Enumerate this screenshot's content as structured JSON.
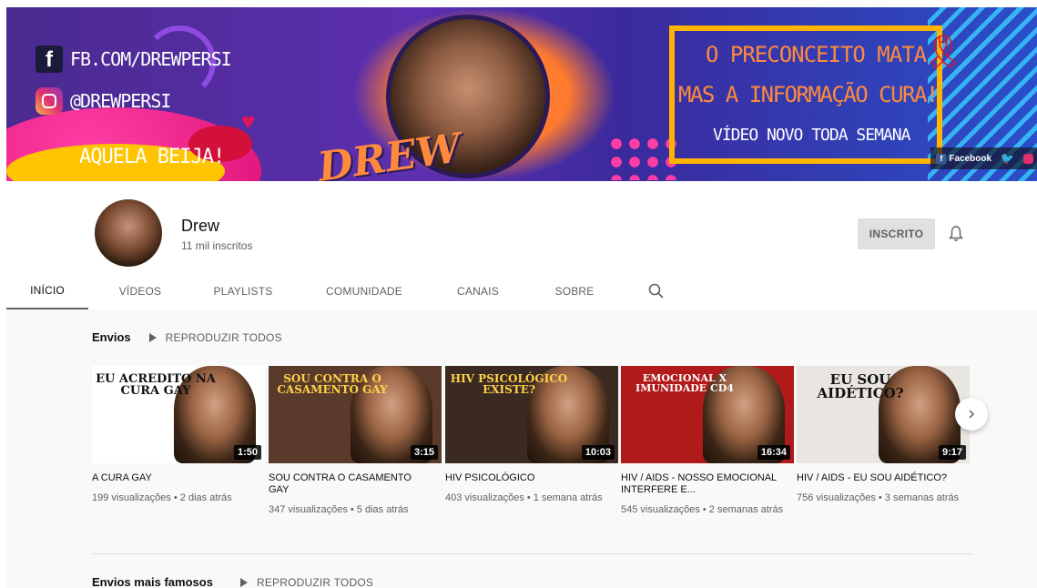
{
  "banner": {
    "facebook_handle": "FB.COM/DREWPERSI",
    "instagram_handle": "@DREWPERSI",
    "kiss_text": "AQUELA BEIJA!",
    "logo_text": "DREW",
    "promo_line1": "O PRECONCEITO MATA",
    "promo_line2": "MAS A INFORMAÇÃO CURA!",
    "promo_line3": "VÍDEO NOVO TODA SEMANA",
    "link_facebook": "Facebook"
  },
  "channel": {
    "name": "Drew",
    "subscribers": "11 mil inscritos",
    "subscribed_label": "INSCRITO"
  },
  "tabs": [
    {
      "label": "INÍCIO",
      "active": true
    },
    {
      "label": "VÍDEOS"
    },
    {
      "label": "PLAYLISTS"
    },
    {
      "label": "COMUNIDADE"
    },
    {
      "label": "CANAIS"
    },
    {
      "label": "SOBRE"
    }
  ],
  "uploads": {
    "title": "Envios",
    "play_all": "REPRODUZIR TODOS",
    "videos": [
      {
        "thumb_text": "EU ACREDITO NA CURA GAY",
        "duration": "1:50",
        "title": "A CURA GAY",
        "views": "199 visualizações • 2 dias atrás",
        "bg": "#ffffff",
        "fg": "#111111"
      },
      {
        "thumb_text": "SOU CONTRA O CASAMENTO GAY",
        "duration": "3:15",
        "title": "SOU CONTRA O CASAMENTO GAY",
        "views": "347 visualizações • 5 dias atrás",
        "bg": "#5a3a2a",
        "fg": "#ffd24a"
      },
      {
        "thumb_text": "HIV PSICOLÓGICO EXISTE?",
        "duration": "10:03",
        "title": "HIV PSICOLÓGICO",
        "views": "403 visualizações • 1 semana atrás",
        "bg": "#3a2a22",
        "fg": "#ffd24a"
      },
      {
        "thumb_text": "EMOCIONAL X IMUNIDADE CD4",
        "duration": "16:34",
        "title": "HIV / AIDS - NOSSO EMOCIONAL INTERFERE E...",
        "views": "545 visualizações • 2 semanas atrás",
        "bg": "#b01a1a",
        "fg": "#ffffff"
      },
      {
        "thumb_text": "EU SOU AIDÉTICO?",
        "duration": "9:17",
        "title": "HIV / AIDS - EU SOU AIDÉTICO?",
        "views": "756 visualizações • 3 semanas atrás",
        "bg": "#e9e6e2",
        "fg": "#111111"
      }
    ]
  },
  "popular": {
    "title": "Envios mais famosos",
    "play_all": "REPRODUZIR TODOS"
  }
}
